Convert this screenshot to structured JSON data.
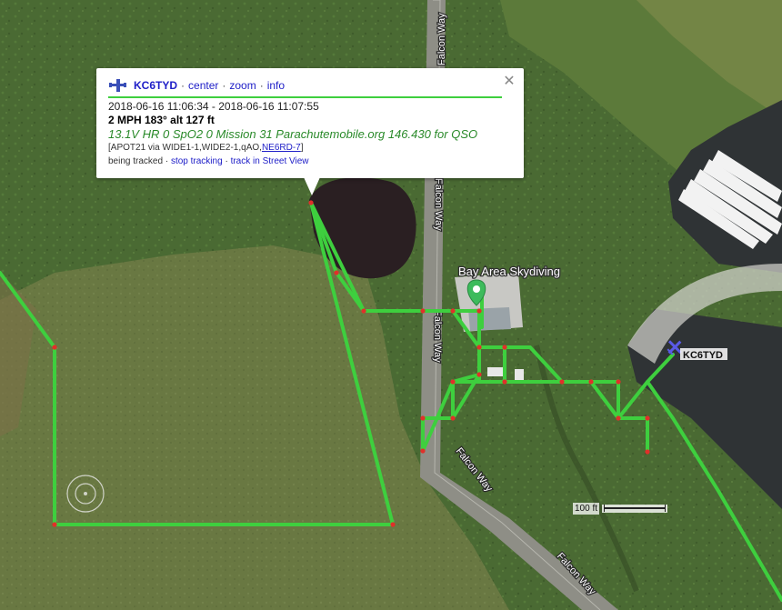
{
  "map": {
    "place_label": "Bay Area Skydiving",
    "road_labels": [
      "Falcon Way",
      "Falcon Way",
      "Falcon Way",
      "Falcon Way",
      "Falcon Way"
    ],
    "aircraft_label": "KC6TYD",
    "track_color": "#3ecf3e",
    "point_color": "#e0302a",
    "marker_color": "#3dbb5c",
    "scale_text": "100 ft"
  },
  "popup": {
    "callsign": "KC6TYD",
    "actions": [
      "center",
      "zoom",
      "info"
    ],
    "close_icon": "close-icon",
    "time_range": "2018-06-16 11:06:34 - 2018-06-16 11:07:55",
    "speed_line": "2 MPH 183° alt 127 ft",
    "comment": "13.1V HR 0 SpO2 0 Mission 31 Parachutemobile.org 146.430 for QSO",
    "path_prefix": "[APOT21 via WIDE1-1,WIDE2-1,qAO,",
    "path_digi": "NE6RD-7",
    "path_suffix": "]",
    "tracked_text": "being tracked",
    "stop_tracking": "stop tracking",
    "street_view": "track in Street View"
  }
}
